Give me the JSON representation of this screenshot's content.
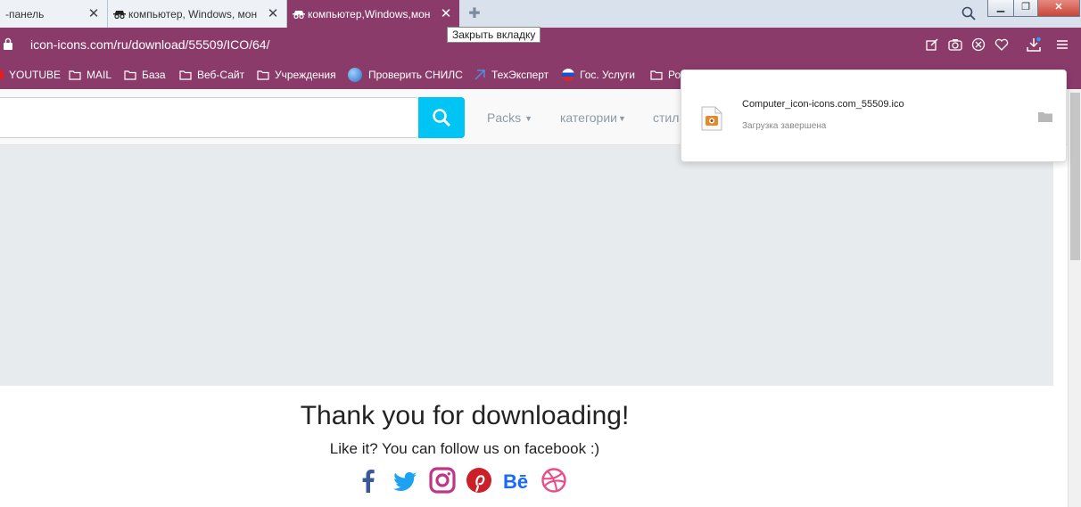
{
  "tabs": [
    {
      "label": "-панель",
      "active": false
    },
    {
      "label": "компьютер, Windows, мон",
      "active": false
    },
    {
      "label": "компьютер,Windows,мон",
      "active": true
    }
  ],
  "tooltip": "Закрыть вкладку",
  "address": {
    "url": "icon-icons.com/ru/download/55509/ICO/64/"
  },
  "bookmarks": [
    "YOUTUBE",
    "MAIL",
    "База",
    "Веб-Сайт",
    "Учреждения",
    "Проверить СНИЛС",
    "ТехЭксперт",
    "Гос. Услуги",
    "Ро"
  ],
  "site_nav": {
    "search_placeholder": "",
    "links": [
      "Packs",
      "категории",
      "стил"
    ]
  },
  "content": {
    "thanks": "Thank you for downloading!",
    "follow": "Like it? You can follow us on facebook :)",
    "social": [
      "facebook-icon",
      "twitter-icon",
      "instagram-icon",
      "pinterest-icon",
      "behance-icon",
      "dribbble-icon"
    ]
  },
  "download": {
    "filename": "Computer_icon-icons.com_55509.ico",
    "status": "Загрузка завершена"
  },
  "colors": {
    "accent": "#8a3b6a",
    "search_button": "#00c4f4"
  }
}
